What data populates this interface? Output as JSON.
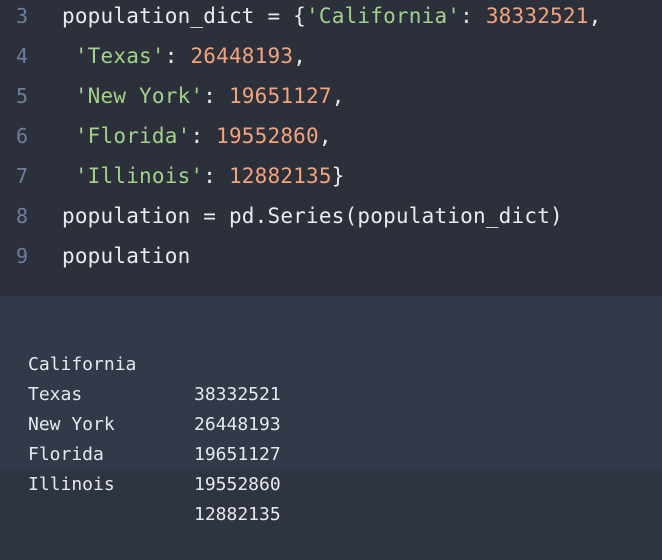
{
  "editor": {
    "lines": [
      {
        "number": "3",
        "p1": "population_dict = {",
        "s1": "'California'",
        "p2": ": ",
        "n1": "38332521",
        "p3": ","
      },
      {
        "number": "4",
        "p1": " ",
        "s1": "'Texas'",
        "p2": ": ",
        "n1": "26448193",
        "p3": ","
      },
      {
        "number": "5",
        "p1": " ",
        "s1": "'New York'",
        "p2": ": ",
        "n1": "19651127",
        "p3": ","
      },
      {
        "number": "6",
        "p1": " ",
        "s1": "'Florida'",
        "p2": ": ",
        "n1": "19552860",
        "p3": ","
      },
      {
        "number": "7",
        "p1": " ",
        "s1": "'Illinois'",
        "p2": ": ",
        "n1": "12882135",
        "p3": "}"
      },
      {
        "number": "8",
        "text": "population = pd.Series(population_dict)"
      },
      {
        "number": "9",
        "text": "population"
      }
    ]
  },
  "output": {
    "rows": [
      {
        "label": "California",
        "value": "38332521"
      },
      {
        "label": "Texas",
        "value": "26448193"
      },
      {
        "label": "New York",
        "value": "19651127"
      },
      {
        "label": "Florida",
        "value": "19552860"
      },
      {
        "label": "Illinois",
        "value": "12882135"
      }
    ]
  },
  "colors": {
    "editor_bg": "#2b303b",
    "output_bg": "#323948",
    "line_number": "#6d7f99",
    "string": "#a3d18b",
    "number": "#f3a47c",
    "text": "#e8ecf1"
  }
}
